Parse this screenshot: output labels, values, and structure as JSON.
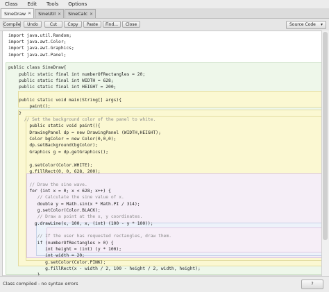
{
  "menu": [
    "Class",
    "Edit",
    "Tools",
    "Options"
  ],
  "tabs": [
    {
      "label": "SineDraw",
      "close": "✕",
      "active": true
    },
    {
      "label": "SineUtil",
      "close": "✕",
      "active": false
    },
    {
      "label": "SineCalc",
      "close": "✕",
      "active": false
    }
  ],
  "toolbar": {
    "buttons": [
      "Compile",
      "Undo",
      "Cut",
      "Copy",
      "Paste",
      "Find...",
      "Close"
    ],
    "view_select": "Source Code",
    "view_chevron": "▾"
  },
  "code_lines": [
    "import java.util.Random;",
    "import java.awt.Color;",
    "import java.awt.Graphics;",
    "import java.awt.Panel;",
    "",
    "public class SineDraw{",
    "    public static final int numberOfRectangles = 20;",
    "    public static final int WIDTH = 628;",
    "    public static final int HEIGHT = 200;",
    "",
    "    public static void main(String[] args){",
    "        paint();",
    "    }",
    "      // Set the background color of the panel to white.",
    "        public static void paint(){",
    "        DrawingPanel dp = new DrawingPanel (WIDTH,HEIGHT);",
    "        Color bgColor = new Color(0,0,0);",
    "        dp.setBackground(bgColor);",
    "        Graphics g = dp.getGraphics();",
    "",
    "        g.setColor(Color.WHITE);",
    "        g.fillRect(0, 0, 628, 200);",
    "",
    "        // Draw the sine wave.",
    "        for (int x = 0; x < 628; x++) {",
    "           // Calculate the sine value of x.",
    "           double y = Math.sin(x * Math.PI / 314);",
    "           g.setColor(Color.BLACK);",
    "           // Draw a point at the x, y coordinates.",
    "          g.drawLine(x, 100, x, (int) (100 - y * 100));",
    "",
    "           // If the user has requested rectangles, draw them.",
    "           if (numberOfRectangles > 0) {",
    "              int height = (int) (y * 100);",
    "              int width = 20;",
    "              g.setColor(Color.PINK);",
    "              g.fillRect(x - width / 2, 100 - height / 2, width, height);",
    "           }",
    "        }",
    "    }",
    "}"
  ],
  "status": {
    "message": "Class compiled - no syntax errors",
    "button": "?"
  }
}
